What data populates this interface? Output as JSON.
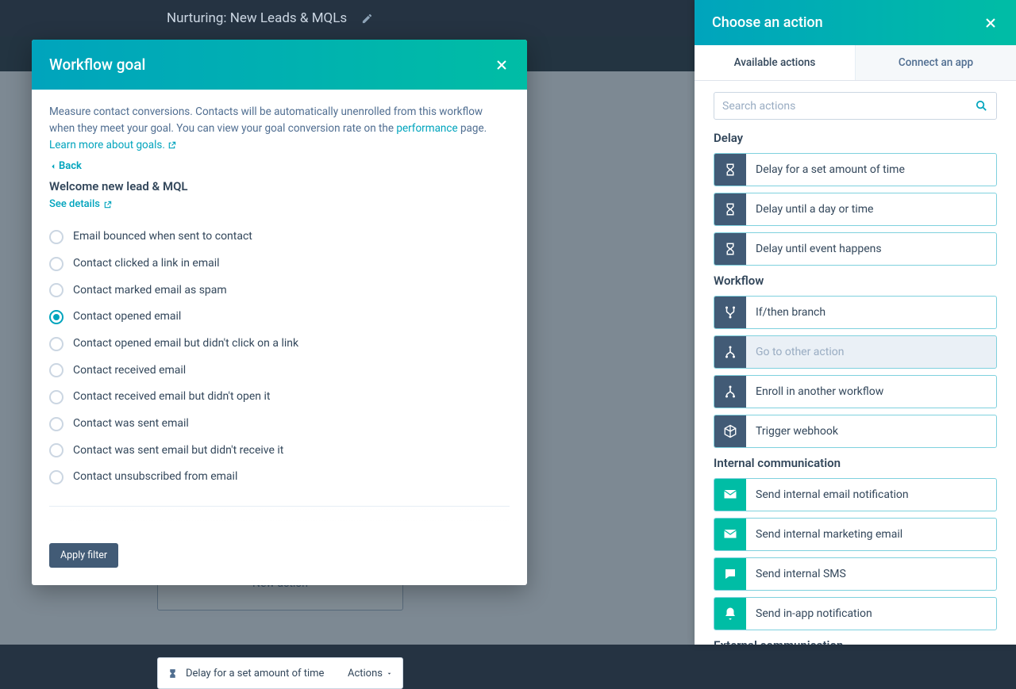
{
  "header": {
    "title": "Nurturing: New Leads & MQLs"
  },
  "canvas": {
    "new_action_label": "New action",
    "delay_card_label": "Delay for a set amount of time",
    "delay_card_actions": "Actions"
  },
  "modal": {
    "title": "Workflow goal",
    "desc_part1": "Measure contact conversions. Contacts will be automatically unenrolled from this workflow when they meet your goal. You can view your goal conversion rate on the ",
    "perf_link": "performance",
    "desc_part2": " page. ",
    "learn_link": "Learn more about goals.",
    "back_label": "Back",
    "section_title": "Welcome new lead & MQL",
    "see_details": "See details",
    "radios": [
      {
        "label": "Email bounced when sent to contact"
      },
      {
        "label": "Contact clicked a link in email"
      },
      {
        "label": "Contact marked email as spam"
      },
      {
        "label": "Contact opened email"
      },
      {
        "label": "Contact opened email but didn't click on a link"
      },
      {
        "label": "Contact received email"
      },
      {
        "label": "Contact received email but didn't open it"
      },
      {
        "label": "Contact was sent email"
      },
      {
        "label": "Contact was sent email but didn't receive it"
      },
      {
        "label": "Contact unsubscribed from email"
      }
    ],
    "selected_index": 3,
    "apply_button": "Apply filter"
  },
  "panel": {
    "title": "Choose an action",
    "tabs": {
      "active": "Available actions",
      "inactive": "Connect an app"
    },
    "search_placeholder": "Search actions",
    "groups": [
      {
        "label": "Delay",
        "icon_type": "dark",
        "items": [
          {
            "label": "Delay for a set amount of time",
            "icon": "hourglass"
          },
          {
            "label": "Delay until a day or time",
            "icon": "hourglass"
          },
          {
            "label": "Delay until event happens",
            "icon": "hourglass"
          }
        ]
      },
      {
        "label": "Workflow",
        "icon_type": "dark",
        "items": [
          {
            "label": "If/then branch",
            "icon": "branch"
          },
          {
            "label": "Go to other action",
            "icon": "merge",
            "hovered": true
          },
          {
            "label": "Enroll in another workflow",
            "icon": "merge"
          },
          {
            "label": "Trigger webhook",
            "icon": "cube"
          }
        ]
      },
      {
        "label": "Internal communication",
        "icon_type": "teal",
        "items": [
          {
            "label": "Send internal email notification",
            "icon": "mail"
          },
          {
            "label": "Send internal marketing email",
            "icon": "mail"
          },
          {
            "label": "Send internal SMS",
            "icon": "chat"
          },
          {
            "label": "Send in-app notification",
            "icon": "bell"
          }
        ]
      },
      {
        "label": "External communication",
        "icon_type": "teal",
        "items": []
      }
    ]
  }
}
